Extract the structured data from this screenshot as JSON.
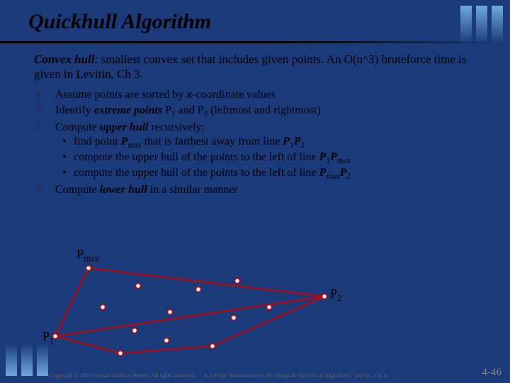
{
  "title": "Quickhull Algorithm",
  "intro": {
    "term": "Convex hull",
    "rest1": ": smallest convex set that includes given points. An O(n^3) bruteforce time is given in Levitin, Ch 3."
  },
  "bullets": {
    "b1_a": "Assume points are sorted by ",
    "b1_b": "x",
    "b1_c": "-coordinate values",
    "b2_a": "Identify ",
    "b2_b": "extreme points",
    "b2_c": " P",
    "b2_d": "1",
    "b2_e": " and P",
    "b2_f": "2",
    "b2_g": "  (leftmost and rightmost)",
    "b3_a": "Compute ",
    "b3_b": "upper hull",
    "b3_c": " recursively:",
    "s1_a": "find point ",
    "s1_b": "P",
    "s1_c": "max",
    "s1_d": " that is farthest away from line ",
    "s1_e": "P",
    "s1_f": "1",
    "s1_g": "P",
    "s1_h": "2",
    "s2_a": "compute the upper hull of the points to the left of line ",
    "s2_b": "P",
    "s2_c": "1",
    "s2_d": "P",
    "s2_e": "max",
    "s3_a": "compute the upper hull of the points to the left of line ",
    "s3_b": "P",
    "s3_c": "max",
    "s3_d": "P",
    "s3_e": "2",
    "b4_a": "Compute ",
    "b4_b": "lower hull",
    "b4_c": " in a similar manner"
  },
  "labels": {
    "pmax_a": "P",
    "pmax_b": "max",
    "p1_a": "P",
    "p1_b": "1",
    "p2_a": "P",
    "p2_b": "2"
  },
  "footer": {
    "copyright": "Copyright © 2007 Pearson Addison-Wesley. All rights reserved.",
    "attribution": "A. Levitin \"Introduction to the Design & Analysis of Algorithms,\" 2nd ed., Ch. 4",
    "page": "4-46"
  }
}
